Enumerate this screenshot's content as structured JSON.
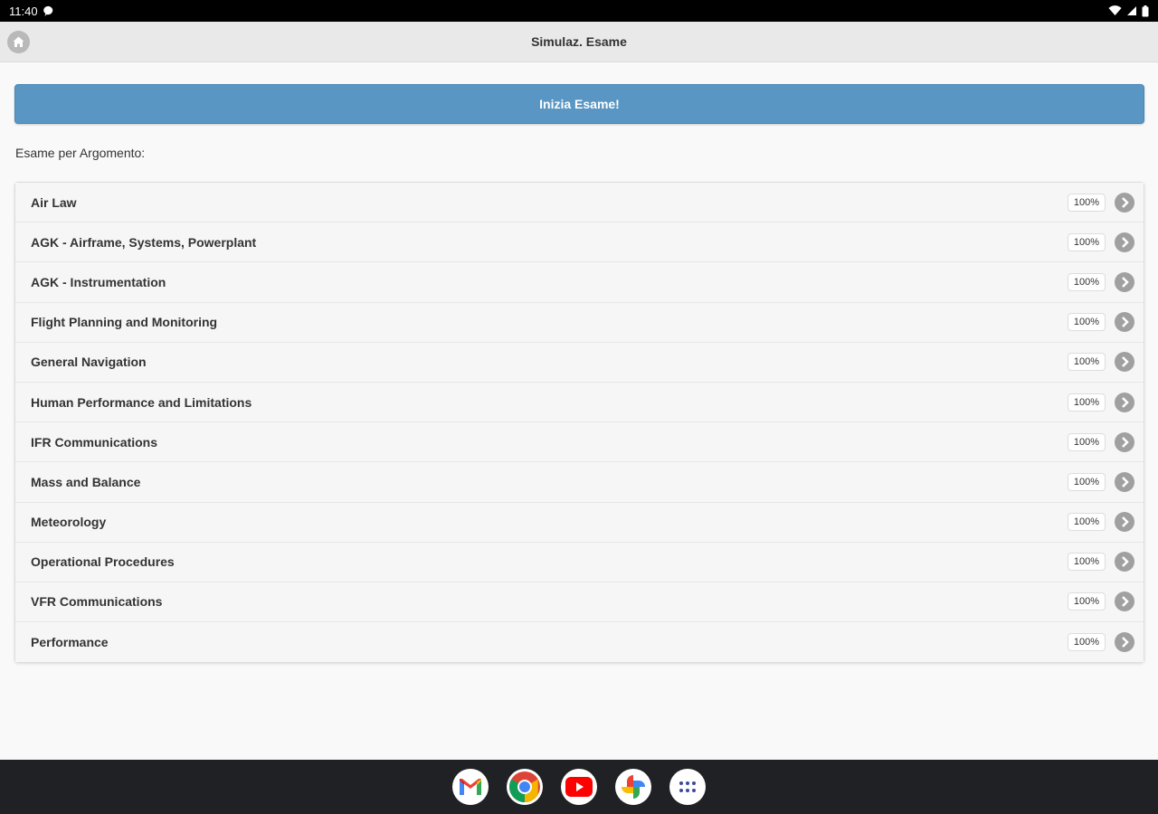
{
  "status_bar": {
    "time": "11:40"
  },
  "header": {
    "title": "Simulaz. Esame"
  },
  "start_button": {
    "label": "Inizia Esame!"
  },
  "section_label": "Esame per Argomento:",
  "topics": [
    {
      "label": "Air Law",
      "count": "100%"
    },
    {
      "label": "AGK - Airframe, Systems, Powerplant",
      "count": "100%"
    },
    {
      "label": "AGK - Instrumentation",
      "count": "100%"
    },
    {
      "label": "Flight Planning and Monitoring",
      "count": "100%"
    },
    {
      "label": "General Navigation",
      "count": "100%"
    },
    {
      "label": "Human Performance and Limitations",
      "count": "100%"
    },
    {
      "label": "IFR Communications",
      "count": "100%"
    },
    {
      "label": "Mass and Balance",
      "count": "100%"
    },
    {
      "label": "Meteorology",
      "count": "100%"
    },
    {
      "label": "Operational Procedures",
      "count": "100%"
    },
    {
      "label": "VFR Communications",
      "count": "100%"
    },
    {
      "label": "Performance",
      "count": "100%"
    }
  ],
  "dock": [
    "gmail-icon",
    "chrome-icon",
    "youtube-icon",
    "photos-icon",
    "app-drawer-icon"
  ],
  "colors": {
    "accent": "#5a96c4",
    "status_bar": "#000000",
    "taskbar": "#202124"
  }
}
